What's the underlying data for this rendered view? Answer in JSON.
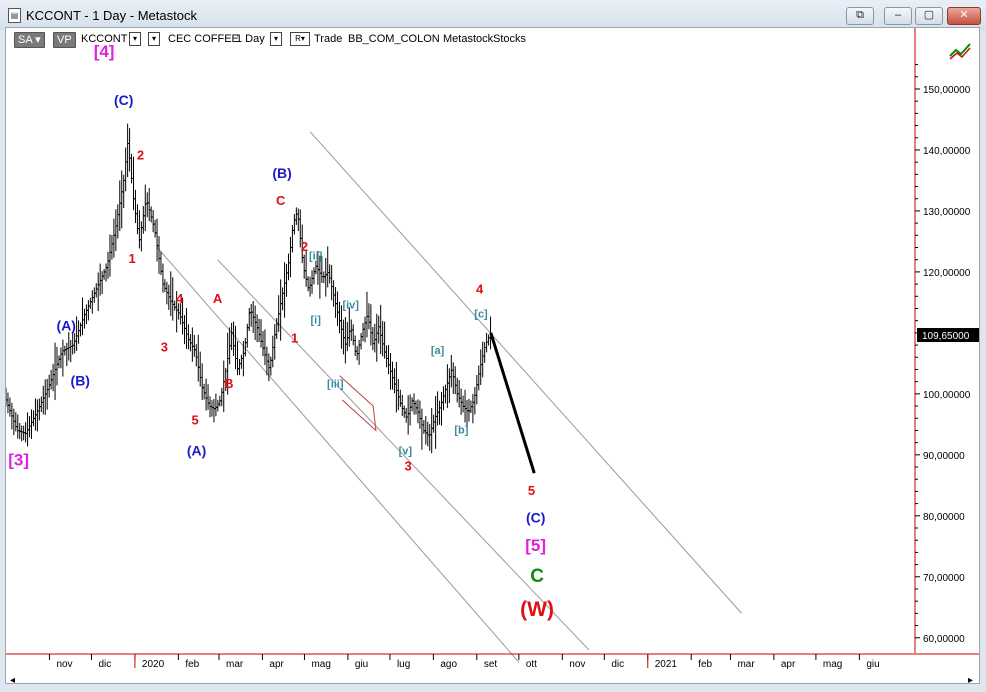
{
  "window": {
    "title": "KCCONT - 1 Day - Metastock",
    "buttons": [
      "restore-extra",
      "minimize",
      "maximize",
      "close"
    ]
  },
  "toolbar": {
    "sa_label": "SA",
    "vp_label": "VP",
    "symbol": "KCCONT",
    "instrument": "CEC COFFEE",
    "period": "1 Day",
    "r_label": "R",
    "trade_label": "Trade",
    "exchange": "BB_COM_COLON",
    "source": "Metastock",
    "asset_type": "Stocks"
  },
  "colors": {
    "magenta": "#e020e0",
    "blue": "#1a1acc",
    "red": "#dd1111",
    "teal": "#3a8aa0",
    "green": "#118a11",
    "axis_red": "#cc0000",
    "price_box": "#000000"
  },
  "chart_data": {
    "type": "candlestick",
    "y_ticks": [
      "150,00000",
      "140,00000",
      "130,00000",
      "120,00000",
      "110,00000",
      "100,00000",
      "90,00000",
      "80,00000",
      "70,00000",
      "60,00000"
    ],
    "y_tick_values": [
      150,
      140,
      130,
      120,
      110,
      100,
      90,
      80,
      70,
      60
    ],
    "ylim": [
      57.5,
      160
    ],
    "current_price_label": "109,65000",
    "current_price": 109.65,
    "x_ticks": [
      "nov",
      "dic",
      "2020",
      "feb",
      "mar",
      "apr",
      "mag",
      "giu",
      "lug",
      "ago",
      "set",
      "ott",
      "nov",
      "dic",
      "2021",
      "feb",
      "mar",
      "apr",
      "mag",
      "giu"
    ],
    "x_tick_days": [
      31,
      61,
      92,
      123,
      152,
      183,
      213,
      244,
      274,
      305,
      336,
      366,
      397,
      427,
      458,
      489,
      517,
      548,
      578,
      609
    ],
    "year_boundaries": [
      92,
      458
    ],
    "xlim": [
      0,
      648
    ],
    "price_path": [
      [
        0,
        99
      ],
      [
        8,
        94
      ],
      [
        14,
        93.5
      ],
      [
        22,
        97
      ],
      [
        30,
        101
      ],
      [
        40,
        107
      ],
      [
        48,
        108
      ],
      [
        56,
        113
      ],
      [
        64,
        117
      ],
      [
        72,
        121
      ],
      [
        78,
        127
      ],
      [
        84,
        135
      ],
      [
        87,
        141.5
      ],
      [
        91,
        132
      ],
      [
        95,
        125
      ],
      [
        100,
        132
      ],
      [
        106,
        127
      ],
      [
        112,
        118
      ],
      [
        118,
        115
      ],
      [
        124,
        113
      ],
      [
        130,
        109
      ],
      [
        135,
        107
      ],
      [
        140,
        101
      ],
      [
        145,
        98
      ],
      [
        149,
        97.5
      ],
      [
        153,
        99
      ],
      [
        157,
        104
      ],
      [
        161,
        110
      ],
      [
        165,
        104
      ],
      [
        170,
        107
      ],
      [
        174,
        114
      ],
      [
        179,
        111
      ],
      [
        184,
        107
      ],
      [
        188,
        104
      ],
      [
        192,
        110
      ],
      [
        197,
        116
      ],
      [
        202,
        122
      ],
      [
        205,
        128
      ],
      [
        208,
        130
      ],
      [
        212,
        121
      ],
      [
        216,
        117
      ],
      [
        221,
        121
      ],
      [
        226,
        119
      ],
      [
        230,
        120
      ],
      [
        234,
        116
      ],
      [
        238,
        112
      ],
      [
        242,
        108
      ],
      [
        246,
        111
      ],
      [
        250,
        106
      ],
      [
        254,
        110
      ],
      [
        258,
        113
      ],
      [
        262,
        108
      ],
      [
        266,
        111
      ],
      [
        270,
        107
      ],
      [
        274,
        104
      ],
      [
        278,
        101
      ],
      [
        282,
        98
      ],
      [
        286,
        96
      ],
      [
        290,
        99
      ],
      [
        294,
        97
      ],
      [
        298,
        94
      ],
      [
        302,
        93
      ],
      [
        306,
        96
      ],
      [
        310,
        98
      ],
      [
        314,
        101
      ],
      [
        318,
        104
      ],
      [
        322,
        100
      ],
      [
        326,
        98
      ],
      [
        330,
        97
      ],
      [
        334,
        99
      ],
      [
        338,
        104
      ],
      [
        342,
        108
      ],
      [
        346,
        110
      ]
    ],
    "projection": [
      [
        346,
        110
      ],
      [
        377,
        87
      ]
    ],
    "channels": [
      {
        "from": [
          217,
          143
        ],
        "to": [
          525,
          64
        ]
      },
      {
        "from": [
          151,
          122
        ],
        "to": [
          416,
          58
        ]
      },
      {
        "from": [
          108,
          124
        ],
        "to": [
          366,
          56
        ]
      }
    ],
    "sub_channel": [
      [
        238,
        103
      ],
      [
        262,
        98
      ],
      [
        264,
        94
      ],
      [
        240,
        99
      ]
    ],
    "wave_labels": [
      {
        "text": "[4]",
        "color": "magenta",
        "day": 70,
        "price": 156,
        "size": 17
      },
      {
        "text": "(C)",
        "color": "blue",
        "day": 84,
        "price": 148,
        "size": 14
      },
      {
        "text": "2",
        "color": "red",
        "day": 96,
        "price": 139,
        "size": 13
      },
      {
        "text": "1",
        "color": "red",
        "day": 90,
        "price": 122,
        "size": 13
      },
      {
        "text": "4",
        "color": "red",
        "day": 124,
        "price": 115.5,
        "size": 13
      },
      {
        "text": "3",
        "color": "red",
        "day": 113,
        "price": 107.5,
        "size": 13
      },
      {
        "text": "5",
        "color": "red",
        "day": 135,
        "price": 95.5,
        "size": 13
      },
      {
        "text": "A",
        "color": "red",
        "day": 151,
        "price": 115.5,
        "size": 13
      },
      {
        "text": "B",
        "color": "red",
        "day": 159,
        "price": 101.5,
        "size": 13
      },
      {
        "text": "(A)",
        "color": "blue",
        "day": 136,
        "price": 90.5,
        "size": 14
      },
      {
        "text": "(A)",
        "color": "blue",
        "day": 43,
        "price": 111,
        "size": 14
      },
      {
        "text": "(B)",
        "color": "blue",
        "day": 53,
        "price": 102,
        "size": 14
      },
      {
        "text": "[3]",
        "color": "magenta",
        "day": 9,
        "price": 89,
        "size": 17
      },
      {
        "text": "(B)",
        "color": "blue",
        "day": 197,
        "price": 136,
        "size": 14
      },
      {
        "text": "C",
        "color": "red",
        "day": 196,
        "price": 131.5,
        "size": 13
      },
      {
        "text": "2",
        "color": "red",
        "day": 213,
        "price": 124,
        "size": 13
      },
      {
        "text": "[ii]",
        "color": "teal",
        "day": 221,
        "price": 122.5,
        "size": 11
      },
      {
        "text": "1",
        "color": "red",
        "day": 206,
        "price": 109,
        "size": 13
      },
      {
        "text": "[i]",
        "color": "teal",
        "day": 221,
        "price": 112,
        "size": 11
      },
      {
        "text": "[iv]",
        "color": "teal",
        "day": 246,
        "price": 114.5,
        "size": 11
      },
      {
        "text": "[iii]",
        "color": "teal",
        "day": 235,
        "price": 101.5,
        "size": 11
      },
      {
        "text": "[v]",
        "color": "teal",
        "day": 285,
        "price": 90.5,
        "size": 11
      },
      {
        "text": "3",
        "color": "red",
        "day": 287,
        "price": 88,
        "size": 13
      },
      {
        "text": "[a]",
        "color": "teal",
        "day": 308,
        "price": 107,
        "size": 11
      },
      {
        "text": "[b]",
        "color": "teal",
        "day": 325,
        "price": 94,
        "size": 11
      },
      {
        "text": "4",
        "color": "red",
        "day": 338,
        "price": 117,
        "size": 13
      },
      {
        "text": "[c]",
        "color": "teal",
        "day": 339,
        "price": 113,
        "size": 11
      },
      {
        "text": "5",
        "color": "red",
        "day": 375,
        "price": 84,
        "size": 13
      },
      {
        "text": "(C)",
        "color": "blue",
        "day": 378,
        "price": 79.5,
        "size": 14
      },
      {
        "text": "[5]",
        "color": "magenta",
        "day": 378,
        "price": 75,
        "size": 17
      },
      {
        "text": "C",
        "color": "green",
        "day": 379,
        "price": 70,
        "size": 19
      },
      {
        "text": "(W)",
        "color": "red",
        "day": 379,
        "price": 64.5,
        "size": 21
      }
    ]
  }
}
